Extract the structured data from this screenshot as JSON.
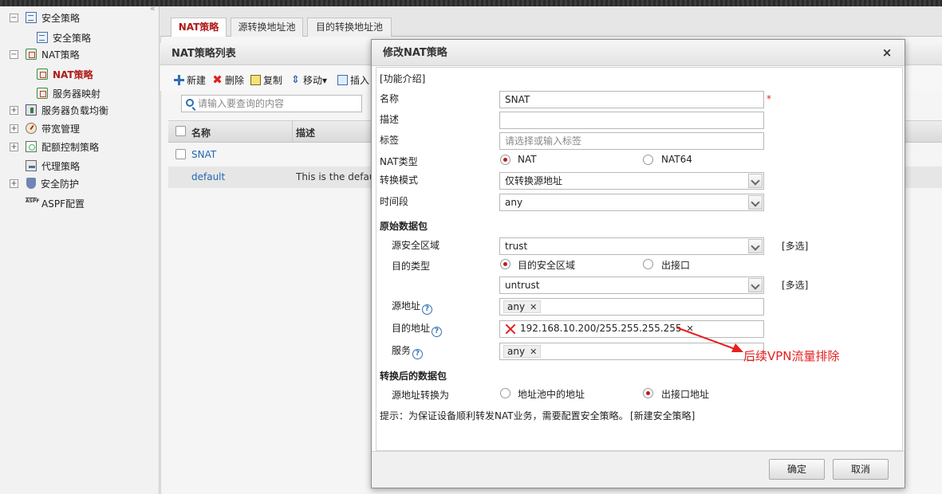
{
  "sidebar": {
    "items": [
      {
        "label": "安全策略",
        "toggle": "−",
        "icon": "policy-doc-icon"
      },
      {
        "label": "安全策略",
        "icon": "policy-doc-icon"
      },
      {
        "label": "NAT策略",
        "toggle": "−",
        "icon": "nat-icon"
      },
      {
        "label": "NAT策略",
        "icon": "nat-icon",
        "selected": true
      },
      {
        "label": "服务器映射",
        "icon": "nat-icon"
      },
      {
        "label": "服务器负载均衡",
        "toggle": "+",
        "icon": "load-balance-icon"
      },
      {
        "label": "带宽管理",
        "toggle": "+",
        "icon": "bandwidth-icon"
      },
      {
        "label": "配额控制策略",
        "toggle": "+",
        "icon": "quota-icon"
      },
      {
        "label": "代理策略",
        "icon": "proxy-icon"
      },
      {
        "label": "安全防护",
        "toggle": "+",
        "icon": "shield-icon"
      },
      {
        "label": "ASPF配置",
        "icon": "aspf-icon"
      }
    ],
    "collapse_glyph": "«"
  },
  "tabs": [
    {
      "label": "NAT策略",
      "active": true
    },
    {
      "label": "源转换地址池"
    },
    {
      "label": "目的转换地址池"
    }
  ],
  "list": {
    "title": "NAT策略列表",
    "toolbar": {
      "new": "新建",
      "delete": "删除",
      "copy": "复制",
      "move": "移动▾",
      "insert": "插入"
    },
    "search_placeholder": "请输入要查询的内容",
    "columns": {
      "name": "名称",
      "desc": "描述"
    },
    "rows": [
      {
        "name": "SNAT",
        "desc": ""
      },
      {
        "name": "default",
        "desc": "This is the default"
      }
    ]
  },
  "dialog": {
    "title": "修改NAT策略",
    "close": "×",
    "intro_link": "[功能介绍]",
    "name_label": "名称",
    "name_value": "SNAT",
    "required_mark": "*",
    "desc_label": "描述",
    "desc_value": "",
    "tag_label": "标签",
    "tag_placeholder": "请选择或输入标签",
    "nat_type_label": "NAT类型",
    "nat_type_opt1": "NAT",
    "nat_type_opt2": "NAT64",
    "mode_label": "转换模式",
    "mode_value": "仅转换源地址",
    "time_label": "时间段",
    "time_value": "any",
    "orig_section": "原始数据包",
    "src_zone_label": "源安全区域",
    "src_zone_value": "trust",
    "multi_select": "[多选]",
    "dst_type_label": "目的类型",
    "dst_type_opt1": "目的安全区域",
    "dst_type_opt2": "出接口",
    "dst_zone_value": "untrust",
    "src_addr_label": "源地址",
    "src_addr_tag": "any",
    "dst_addr_label": "目的地址",
    "dst_addr_tag": "192.168.10.200/255.255.255.255",
    "service_label": "服务",
    "service_tag": "any",
    "remove_glyph": "✕",
    "help_glyph": "?",
    "post_section": "转换后的数据包",
    "src_trans_label": "源地址转换为",
    "src_trans_opt1": "地址池中的地址",
    "src_trans_opt2": "出接口地址",
    "hint_text": "提示：为保证设备顺利转发NAT业务，需要配置安全策略。",
    "hint_link": "[新建安全策略]",
    "ok": "确定",
    "cancel": "取消"
  },
  "annotation": {
    "text": "后续VPN流量排除",
    "color": "#e62020"
  },
  "colors": {
    "accent_red": "#b01818",
    "link_blue": "#2466b3",
    "radio_red": "#c01b1b"
  }
}
